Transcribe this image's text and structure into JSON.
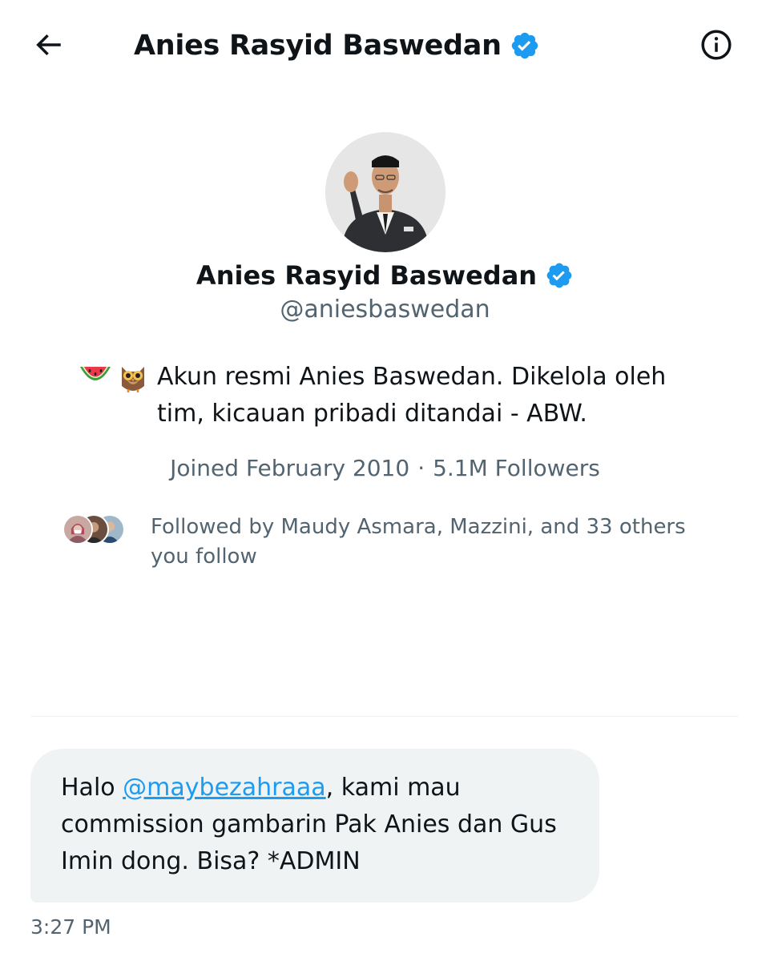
{
  "header": {
    "title": "Anies Rasyid Baswedan"
  },
  "profile": {
    "display_name": "Anies Rasyid Baswedan",
    "handle": "@aniesbaswedan",
    "bio_emoji": [
      "watermelon",
      "owl"
    ],
    "bio": "Akun resmi Anies Baswedan. Dikelola oleh tim, kicauan pribadi ditandai - ABW.",
    "joined": "Joined February 2010",
    "separator": "·",
    "followers": "5.1M Followers",
    "followed_by": "Followed by Maudy Asmara, Mazzini, and 33 others you follow"
  },
  "message": {
    "prefix": "Halo ",
    "mention": "@maybezahraaa",
    "suffix": ", kami mau commission gambarin Pak Anies dan Gus Imin dong. Bisa? *ADMIN",
    "time": "3:27 PM"
  },
  "colors": {
    "verified": "#1d9bf0",
    "secondary_text": "#536471",
    "bubble": "#eff3f4",
    "link": "#1d9bf0"
  }
}
